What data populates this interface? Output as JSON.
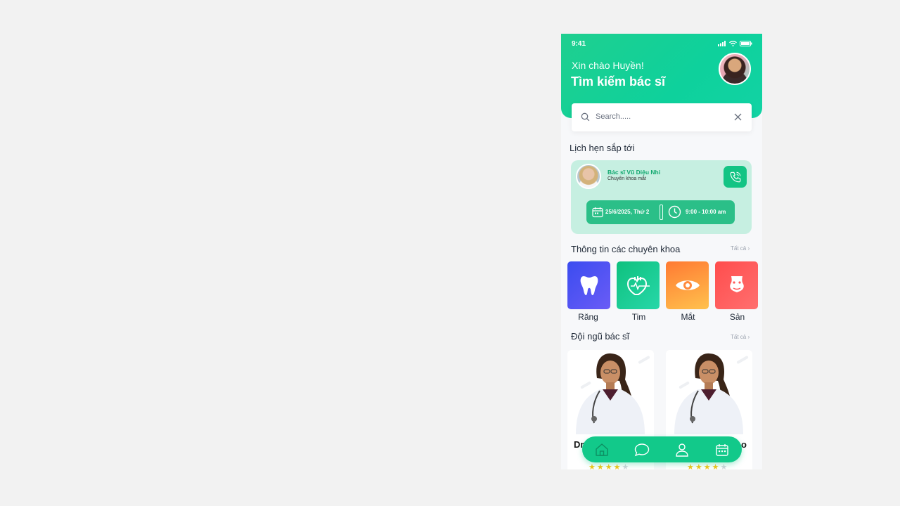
{
  "status": {
    "time": "9:41"
  },
  "header": {
    "greeting": "Xin chào Huyền!",
    "title": "Tìm kiếm bác sĩ"
  },
  "search": {
    "placeholder": "Search....."
  },
  "upcoming": {
    "title": "Lịch hẹn sắp tới",
    "doctor_name": "Bác sĩ Vũ Diệu Nhi",
    "specialty": "Chuyên khoa mắt",
    "date": "25/6/2025, Thứ 2",
    "time": "9:00 - 10:00 am"
  },
  "specialties": {
    "title": "Thông tin các chuyên khoa",
    "see_all": "Tất cả",
    "items": [
      {
        "label": "Răng",
        "icon": "tooth-icon",
        "color": "#4a55f0"
      },
      {
        "label": "Tim",
        "icon": "heart-icon",
        "color": "#16c98d"
      },
      {
        "label": "Mắt",
        "icon": "eye-icon",
        "color": "#ff8a3d"
      },
      {
        "label": "Sản",
        "icon": "body-icon",
        "color": "#ff5a5a"
      }
    ]
  },
  "doctors": {
    "title": "Đội ngũ bác sĩ",
    "see_all": "Tất cả",
    "items": [
      {
        "name_start": "Dr",
        "name_end": "",
        "rating": 4
      },
      {
        "name_start": "",
        "name_end": "o",
        "rating": 4
      }
    ]
  },
  "nav": {
    "items": [
      "home-icon",
      "chat-icon",
      "profile-icon",
      "calendar-icon"
    ]
  },
  "colors": {
    "accent": "#12c98a",
    "accent_light": "#c6efe1"
  }
}
